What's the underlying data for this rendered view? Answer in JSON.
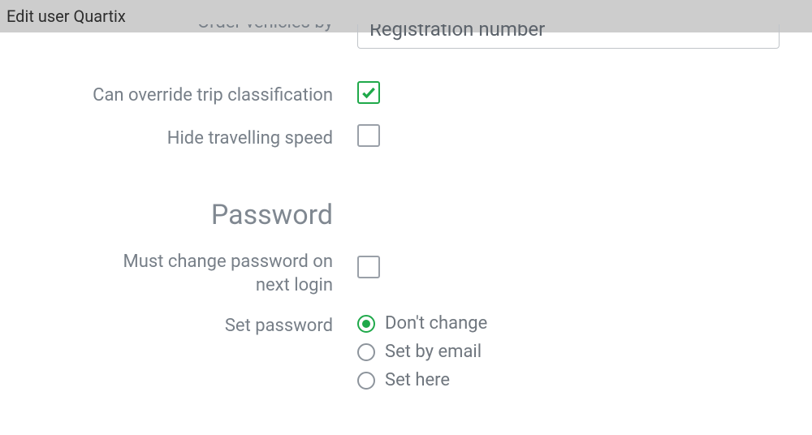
{
  "header": {
    "title": "Edit user Quartix"
  },
  "form": {
    "orderVehicles": {
      "label": "Order vehicles by",
      "value": "Registration number"
    },
    "overrideTrip": {
      "label": "Can override trip classification",
      "checked": true
    },
    "hideSpeed": {
      "label": "Hide travelling speed",
      "checked": false
    }
  },
  "passwordSection": {
    "heading": "Password",
    "mustChange": {
      "label": "Must change password on next login",
      "checked": false
    },
    "setPassword": {
      "label": "Set password",
      "options": [
        {
          "label": "Don't change",
          "selected": true
        },
        {
          "label": "Set by email",
          "selected": false
        },
        {
          "label": "Set here",
          "selected": false
        }
      ]
    }
  }
}
